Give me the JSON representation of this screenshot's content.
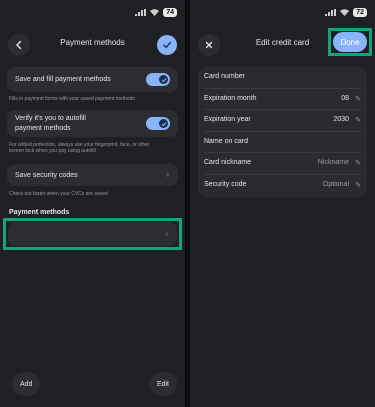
{
  "status": {
    "battery": "74",
    "battery_right": "72"
  },
  "left": {
    "title": "Payment methods",
    "save_fill_label": "Save and fill payment methods",
    "save_fill_caption": "Fills in payment forms with your saved payment methods",
    "verify_label_1": "Verify it's you to autofill",
    "verify_label_2": "payment methods",
    "verify_caption_1": "For added protection, always use your fingerprint, face, or other",
    "verify_caption_2": "screen lock when you pay using autofill",
    "security_codes_label": "Save security codes",
    "security_codes_caption": "Check out faster when your CVCs are saved",
    "section_label": "Payment methods",
    "add_label": "Add",
    "edit_label": "Edit"
  },
  "right": {
    "title": "Edit credit card",
    "done_label": "Done",
    "fields": [
      {
        "label": "Card number",
        "value": ""
      },
      {
        "label": "Expiration month",
        "value": "08"
      },
      {
        "label": "Expiration year",
        "value": "2030"
      },
      {
        "label": "Name on card",
        "value": ""
      },
      {
        "label": "Card nickname",
        "placeholder": "Nickname"
      },
      {
        "label": "Security code",
        "placeholder": "Optional"
      }
    ]
  },
  "colors": {
    "accent": "#8ab4f8",
    "highlight": "#17a27b"
  }
}
